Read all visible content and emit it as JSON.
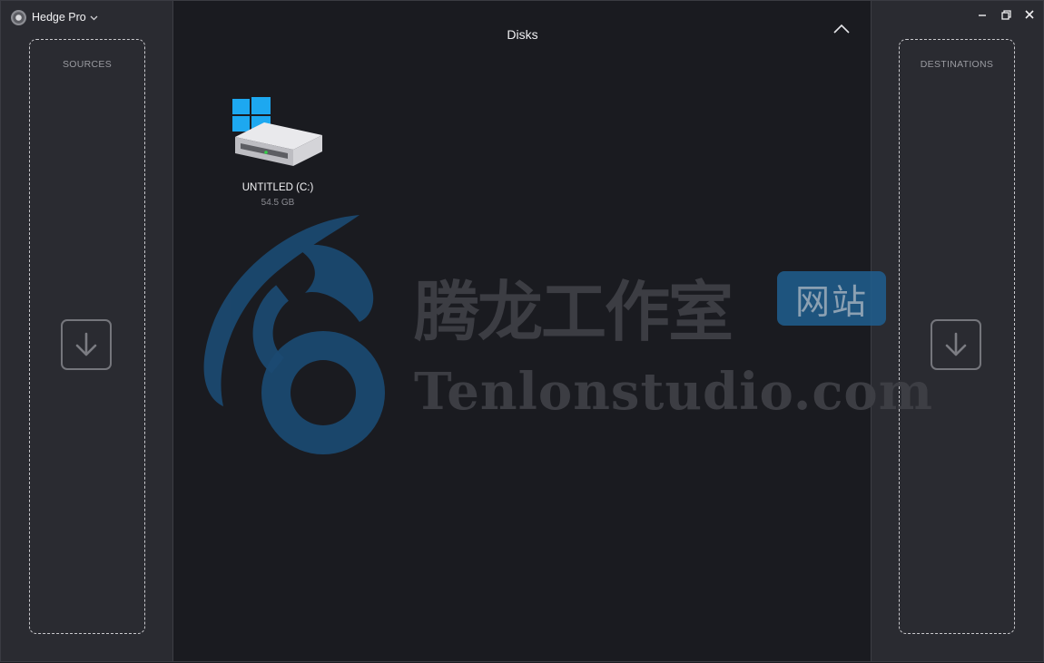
{
  "app": {
    "title": "Hedge Pro"
  },
  "sources": {
    "label": "SOURCES"
  },
  "destinations": {
    "label": "DESTINATIONS"
  },
  "main": {
    "title": "Disks"
  },
  "disks": [
    {
      "name": "UNTITLED (C:)",
      "size": "54.5 GB"
    }
  ],
  "watermark": {
    "cn_text": "腾龙工作室",
    "badge_text": "网站",
    "en_text": "Tenlonstudio.com"
  },
  "icons": {
    "app_logo": "app-logo-icon",
    "app_menu": "chevron-down-icon",
    "sources_drop": "download-arrow-icon",
    "destinations_drop": "download-arrow-icon",
    "collapse": "chevron-up-icon",
    "minimize": "minimize-icon",
    "maximize": "restore-icon",
    "close": "close-icon",
    "disk": "windows-drive-icon"
  },
  "colors": {
    "accent_windows": "#1da1f2",
    "watermark_blue": "#1f5e8f",
    "led_green": "#35d04a"
  }
}
